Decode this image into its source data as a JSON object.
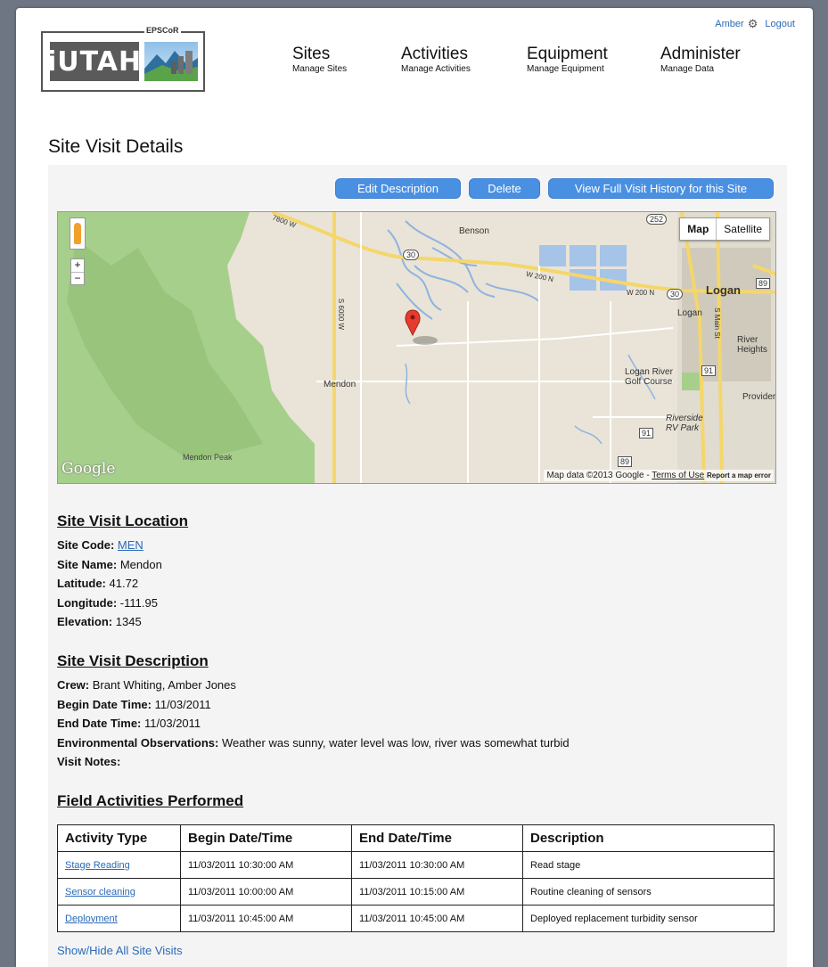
{
  "header": {
    "logo_text": "iUTAH",
    "logo_sub": "EPSCoR",
    "user": "Amber",
    "logout": "Logout"
  },
  "nav": [
    {
      "title": "Sites",
      "sub": "Manage Sites"
    },
    {
      "title": "Activities",
      "sub": "Manage Activities"
    },
    {
      "title": "Equipment",
      "sub": "Manage Equipment"
    },
    {
      "title": "Administer",
      "sub": "Manage Data"
    }
  ],
  "page_title": "Site Visit Details",
  "buttons": {
    "edit": "Edit Description",
    "delete": "Delete",
    "history": "View Full Visit History for this Site"
  },
  "map": {
    "type_map": "Map",
    "type_satellite": "Satellite",
    "zoom_in": "+",
    "zoom_out": "−",
    "credit": "Map data ©2013 Google - ",
    "terms": "Terms of Use",
    "report": "Report a map error",
    "google": "Google",
    "labels": {
      "benson": "Benson",
      "logan": "Logan",
      "logan2": "Logan",
      "mendon": "Mendon",
      "mendon_peak": "Mendon Peak",
      "river_heights": "River Heights",
      "provide": "Provider",
      "golf": "Logan River Golf Course",
      "riverside": "Riverside RV Park",
      "w200n": "W 200 N",
      "w200n2": "W 200 N",
      "s6000w": "S 6000 W",
      "smain": "S Main St",
      "w7800": "7800 W",
      "r30": "30",
      "r30b": "30",
      "r252": "252",
      "r89": "89",
      "r89b": "89",
      "r91": "91",
      "r91b": "91"
    }
  },
  "location": {
    "heading": "Site Visit Location",
    "site_code_label": "Site Code:",
    "site_code": "MEN",
    "site_name_label": "Site Name:",
    "site_name": "Mendon",
    "latitude_label": "Latitude:",
    "latitude": "41.72",
    "longitude_label": "Longitude:",
    "longitude": "-111.95",
    "elevation_label": "Elevation:",
    "elevation": "1345"
  },
  "description": {
    "heading": "Site Visit Description",
    "crew_label": "Crew:",
    "crew": "Brant Whiting, Amber Jones",
    "begin_label": "Begin Date Time:",
    "begin": "11/03/2011",
    "end_label": "End Date Time:",
    "end": "11/03/2011",
    "env_label": "Environmental Observations:",
    "env": "Weather was sunny, water level was low, river was somewhat turbid",
    "notes_label": "Visit Notes:",
    "notes": ""
  },
  "activities": {
    "heading": "Field Activities Performed",
    "columns": [
      "Activity Type",
      "Begin Date/Time",
      "End Date/Time",
      "Description"
    ],
    "rows": [
      {
        "type": "Stage Reading",
        "begin": "11/03/2011 10:30:00 AM",
        "end": "11/03/2011 10:30:00 AM",
        "desc": "Read stage"
      },
      {
        "type": "Sensor cleaning",
        "begin": "11/03/2011 10:00:00 AM",
        "end": "11/03/2011 10:15:00 AM",
        "desc": "Routine cleaning of sensors"
      },
      {
        "type": "Deployment",
        "begin": "11/03/2011 10:45:00 AM",
        "end": "11/03/2011 10:45:00 AM",
        "desc": "Deployed replacement turbidity sensor"
      }
    ]
  },
  "toggle": "Show/Hide All Site Visits"
}
